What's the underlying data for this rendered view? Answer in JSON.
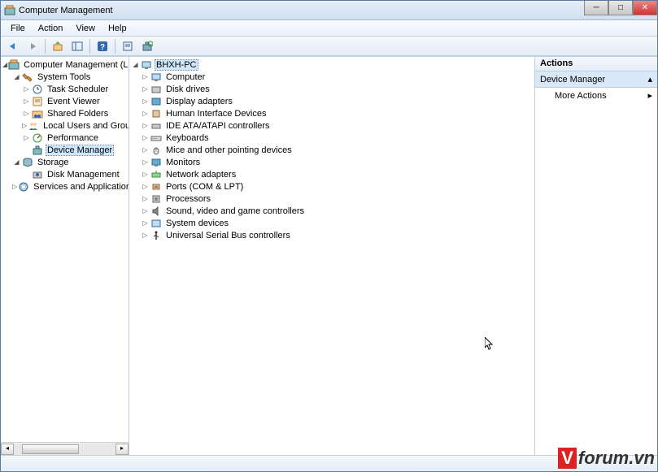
{
  "window": {
    "title": "Computer Management"
  },
  "menu": {
    "file": "File",
    "action": "Action",
    "view": "View",
    "help": "Help"
  },
  "leftTree": {
    "root": "Computer Management (Local",
    "systemTools": "System Tools",
    "taskScheduler": "Task Scheduler",
    "eventViewer": "Event Viewer",
    "sharedFolders": "Shared Folders",
    "localUsers": "Local Users and Groups",
    "performance": "Performance",
    "deviceManager": "Device Manager",
    "storage": "Storage",
    "diskManagement": "Disk Management",
    "servicesApps": "Services and Applications"
  },
  "midTree": {
    "root": "BHXH-PC",
    "computer": "Computer",
    "diskDrives": "Disk drives",
    "displayAdapters": "Display adapters",
    "hid": "Human Interface Devices",
    "ide": "IDE ATA/ATAPI controllers",
    "keyboards": "Keyboards",
    "mice": "Mice and other pointing devices",
    "monitors": "Monitors",
    "network": "Network adapters",
    "ports": "Ports (COM & LPT)",
    "processors": "Processors",
    "sound": "Sound, video and game controllers",
    "systemDevices": "System devices",
    "usb": "Universal Serial Bus controllers"
  },
  "actions": {
    "header": "Actions",
    "section": "Device Manager",
    "more": "More Actions"
  },
  "watermark": {
    "v": "V",
    "text": "forum.vn"
  }
}
